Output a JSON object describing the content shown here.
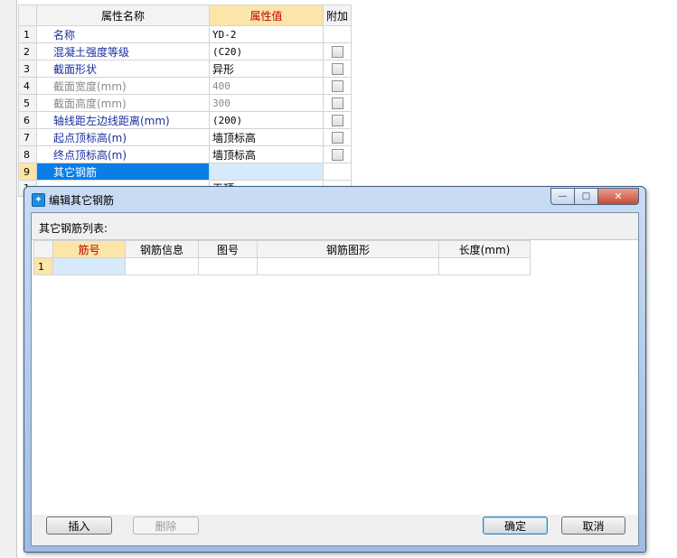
{
  "property_grid": {
    "headers": {
      "name": "属性名称",
      "value": "属性值",
      "extra": "附加"
    },
    "rows": [
      {
        "num": "1",
        "name": "名称",
        "value": "YD-2",
        "checkbox": false
      },
      {
        "num": "2",
        "name": "混凝土强度等级",
        "value": "(C20)",
        "checkbox": true
      },
      {
        "num": "3",
        "name": "截面形状",
        "value": "异形",
        "checkbox": true
      },
      {
        "num": "4",
        "name": "截面宽度(mm)",
        "value": "400",
        "checkbox": true
      },
      {
        "num": "5",
        "name": "截面高度(mm)",
        "value": "300",
        "checkbox": true
      },
      {
        "num": "6",
        "name": "轴线距左边线距离(mm)",
        "value": "(200)",
        "checkbox": true
      },
      {
        "num": "7",
        "name": "起点顶标高(m)",
        "value": "墙顶标高",
        "checkbox": true
      },
      {
        "num": "8",
        "name": "终点顶标高(m)",
        "value": "墙顶标高",
        "checkbox": true
      },
      {
        "num": "9",
        "name": "其它钢筋",
        "value": "",
        "checkbox": false
      }
    ],
    "partial_row": {
      "num": "1",
      "value": "无顶"
    }
  },
  "dialog": {
    "title": "编辑其它钢筋",
    "window_buttons": {
      "minimize": "—",
      "maximize": "□",
      "close": "✕"
    },
    "list_label": "其它钢筋列表:",
    "table": {
      "headers": [
        "筋号",
        "钢筋信息",
        "图号",
        "钢筋图形",
        "长度(mm)"
      ],
      "rows": [
        {
          "num": "1",
          "cells": [
            "",
            "",
            "",
            "",
            ""
          ]
        }
      ]
    },
    "buttons": {
      "insert": "插入",
      "delete": "删除",
      "ok": "确定",
      "cancel": "取消"
    }
  },
  "colors": {
    "selection_blue": "#0a7ee6",
    "header_highlight": "#fbe5a8",
    "header_highlight_text": "#c00000",
    "name_text": "#1a2f9e"
  }
}
